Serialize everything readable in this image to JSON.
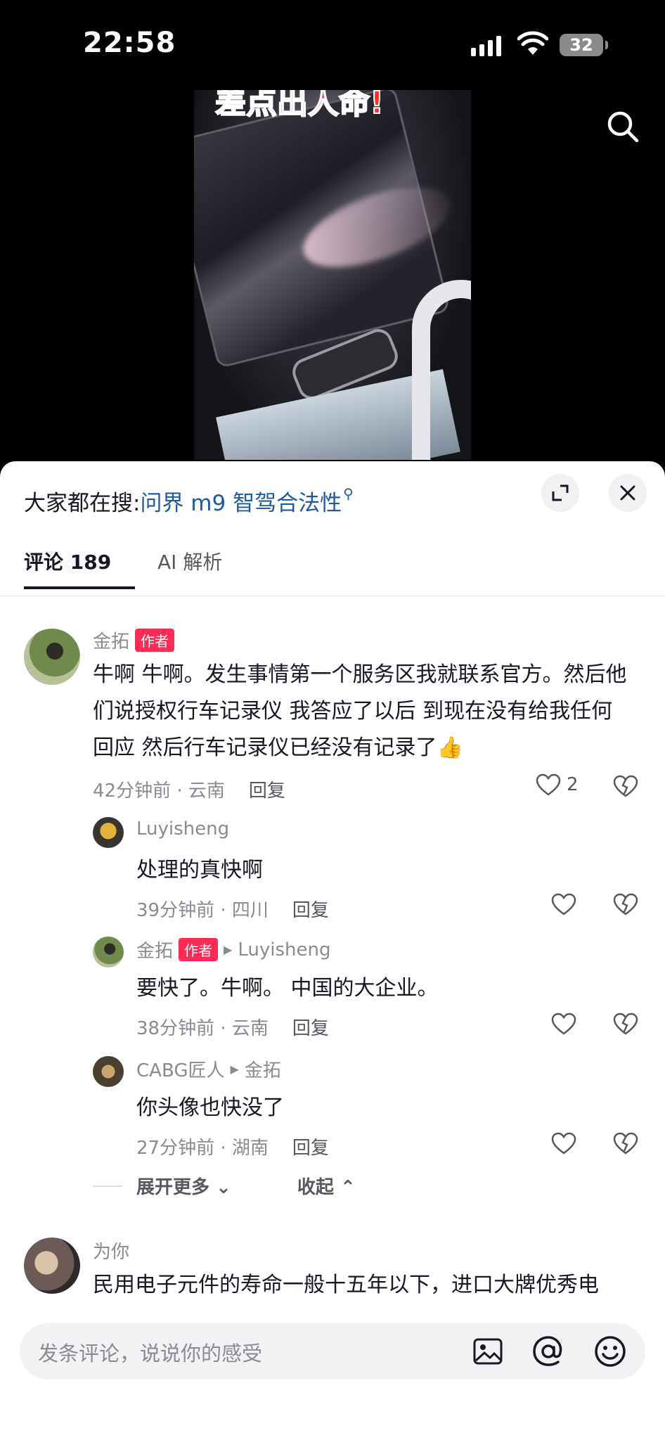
{
  "status": {
    "time": "22:58",
    "battery": "32"
  },
  "video": {
    "caption": "差点出人命!"
  },
  "suggest": {
    "prefix": "大家都在搜:",
    "query": "问界 m9 智驾合法性"
  },
  "tabs": [
    {
      "label": "评论 189"
    },
    {
      "label": "AI 解析"
    }
  ],
  "comments": [
    {
      "name": "金拓",
      "badge": "作者",
      "text": "牛啊 牛啊。发生事情第一个服务区我就联系官方。然后他们说授权行车记录仪 我答应了以后 到现在没有给我任何回应 然后行车记录仪已经没有记录了👍",
      "time": "42分钟前 · 云南",
      "reply": "回复",
      "likes": "2"
    },
    {
      "name": "Luyisheng",
      "text": "处理的真快啊",
      "time": "39分钟前 · 四川",
      "reply": "回复"
    },
    {
      "name": "金拓",
      "badge": "作者",
      "reply_to": "Luyisheng",
      "text": "要快了。牛啊。 中国的大企业。",
      "time": "38分钟前 · 云南",
      "reply": "回复"
    },
    {
      "name": "CABG匠人",
      "reply_to": "金拓",
      "text": "你头像也快没了",
      "time": "27分钟前 · 湖南",
      "reply": "回复"
    },
    {
      "name": "为你",
      "text": "民用电子元件的寿命一般十五年以下，进口大牌优秀电"
    }
  ],
  "more": {
    "expand": "展开更多",
    "collapse": "收起"
  },
  "input": {
    "placeholder": "发条评论，说说你的感受"
  },
  "icons": [
    "search-icon",
    "expand-icon",
    "close-icon",
    "heart-icon",
    "dislike-icon",
    "image-icon",
    "at-icon",
    "emoji-icon"
  ]
}
